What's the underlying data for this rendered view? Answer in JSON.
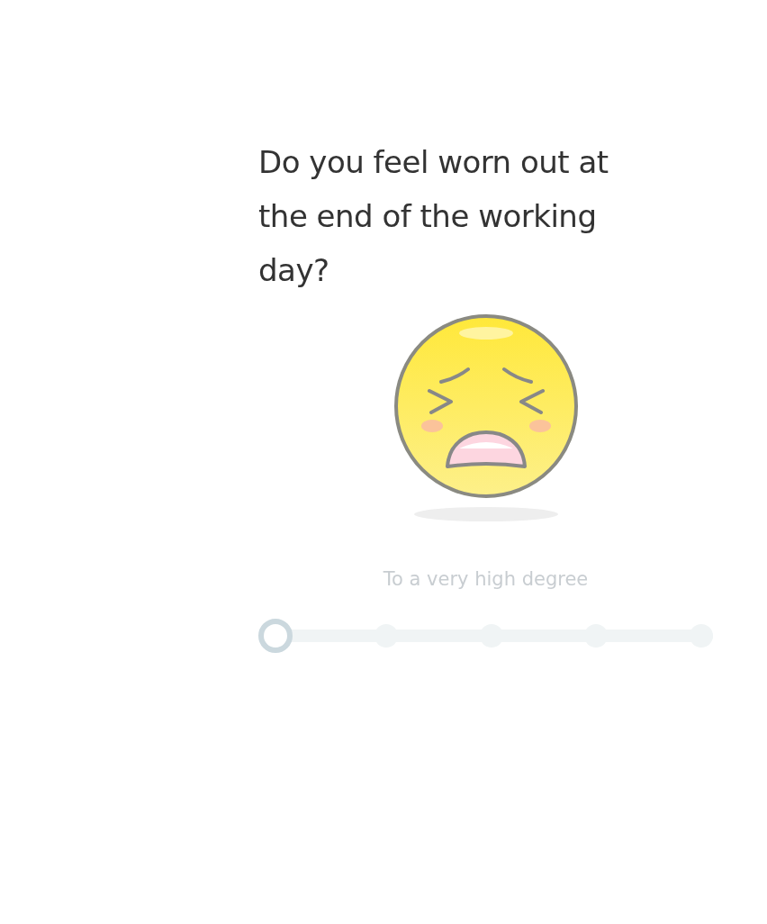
{
  "question": "Do you feel worn out at the end of the working day?",
  "answer_label": "To a very high degree",
  "scale": {
    "steps": [
      {
        "selected": true
      },
      {
        "selected": false
      },
      {
        "selected": false
      },
      {
        "selected": false
      },
      {
        "selected": false
      }
    ]
  }
}
